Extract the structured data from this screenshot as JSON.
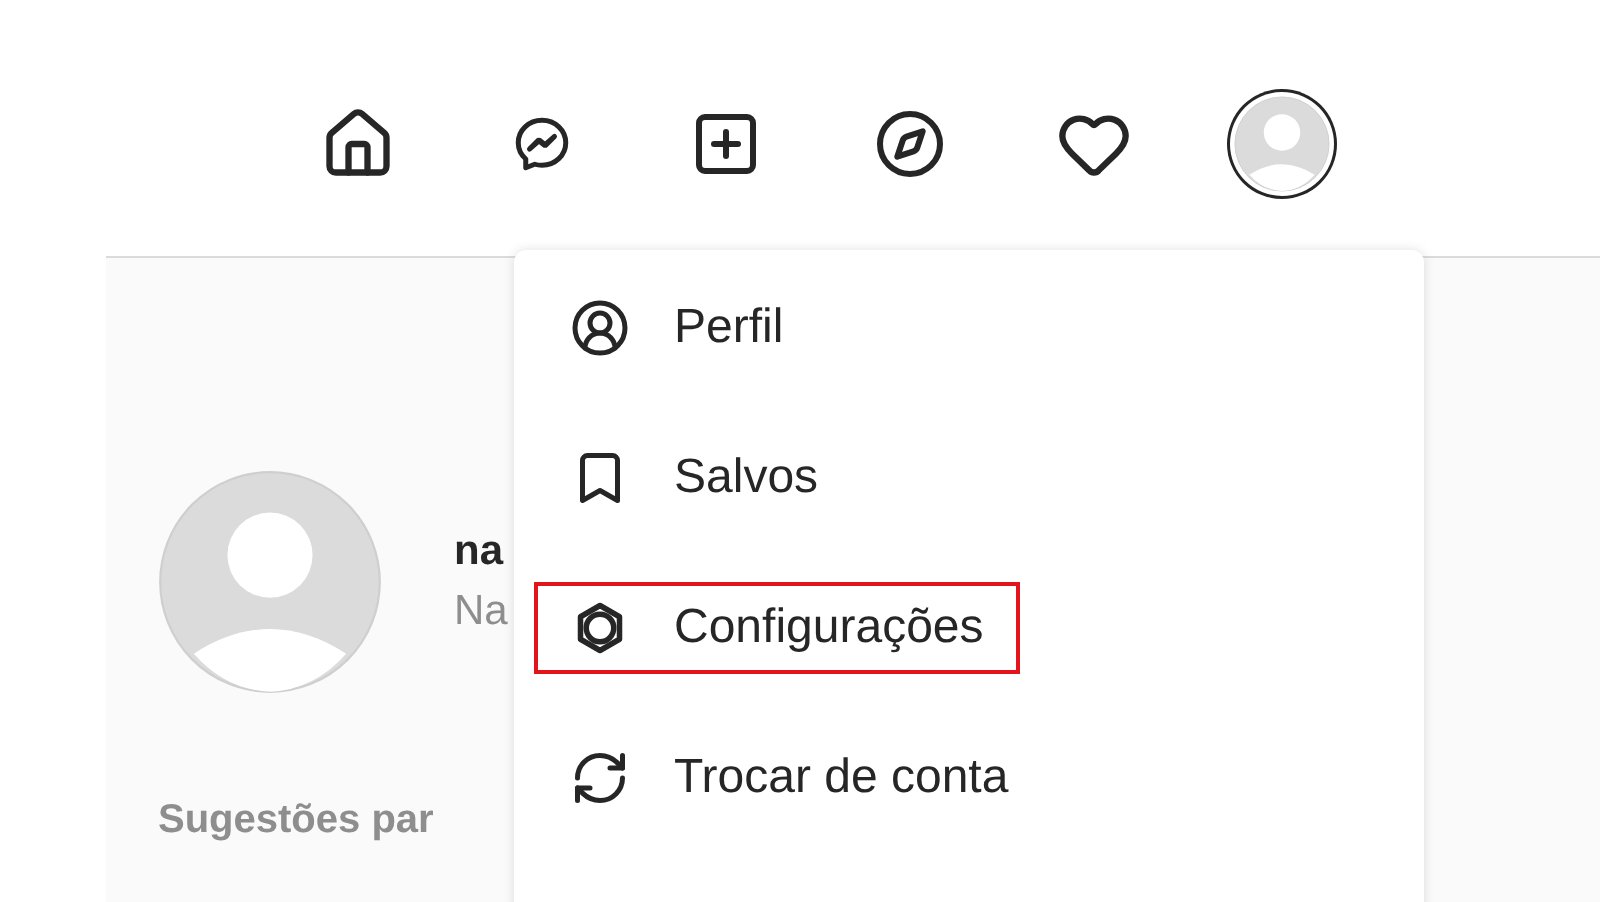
{
  "profile_button": {
    "selected": true
  },
  "profile": {
    "username": "na",
    "name": "Na"
  },
  "suggestions_heading": "Sugestões par",
  "menu": {
    "items": [
      {
        "kind": "profile",
        "label": "Perfil",
        "highlighted": false
      },
      {
        "kind": "saved",
        "label": "Salvos",
        "highlighted": false
      },
      {
        "kind": "settings",
        "label": "Configurações",
        "highlighted": true
      },
      {
        "kind": "switch",
        "label": "Trocar de conta",
        "highlighted": false
      }
    ]
  }
}
